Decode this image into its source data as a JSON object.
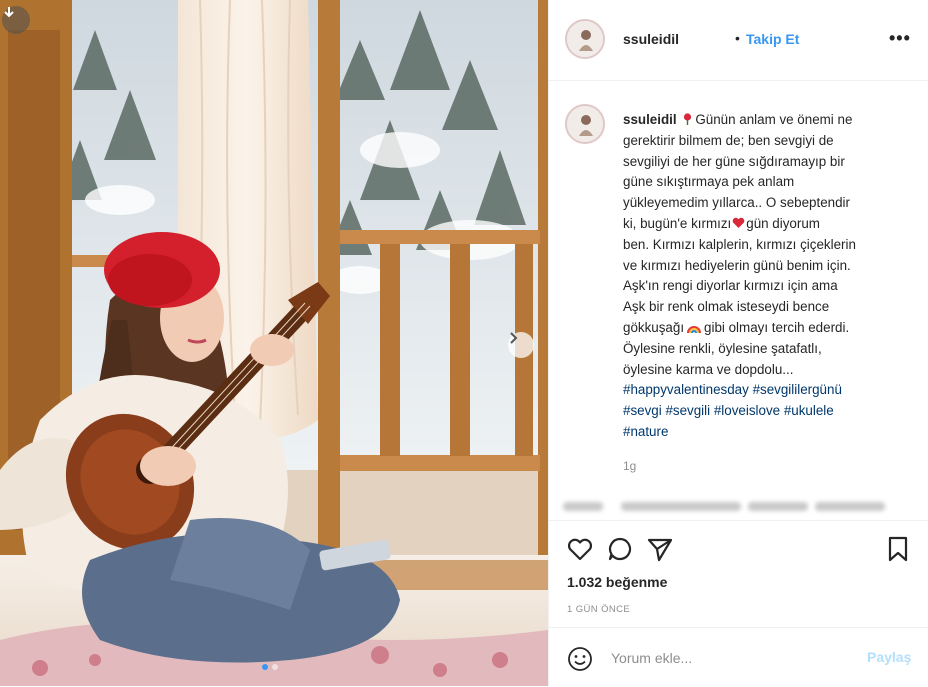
{
  "header": {
    "username": "ssuleidil",
    "separator": "•",
    "follow_label": "Takip Et",
    "more_label": "•••"
  },
  "caption": {
    "username": "ssuleidil",
    "lines": [
      "Günün anlam ve önemi ne",
      "gerektirir bilmem de; ben sevgiyi de",
      "sevgiliyi de her güne sığdıramayıp bir",
      "güne sıkıştırmaya pek anlam",
      "yükleyemedim yıllarca.. O sebeptendir",
      "ki, bugün'e kırmızı",
      "gün diyorum",
      "ben. Kırmızı kalplerin, kırmızı çiçeklerin",
      "ve kırmızı hediyelerin günü benim için.",
      "Aşk'ın rengi diyorlar kırmızı için ama",
      "Aşk bir renk olmak isteseydi bence",
      "gökkuşağı",
      "gibi olmayı tercih ederdi.",
      "Öylesine renkli, öylesine şatafatlı,",
      "öylesine karma ve dopdolu..."
    ],
    "hashtags_line1": [
      "#happyvalentinesday",
      "#sevgililergünü"
    ],
    "hashtags_line2": [
      "#sevgi",
      "#sevgili",
      "#loveislove",
      "#ukulele"
    ],
    "hashtags_line3": [
      "#nature"
    ],
    "time_ago": "1g"
  },
  "actions": {
    "likes": "1.032 beğenme",
    "date": "1 GÜN ÖNCE"
  },
  "comment": {
    "placeholder": "Yorum ekle...",
    "share_label": "Paylaş"
  },
  "colors": {
    "link_blue": "#3897f0",
    "hashtag_blue": "#00376b",
    "heart_red": "#d8283a",
    "share_disabled": "#b2dffc"
  },
  "icons": {
    "heart": "heart-icon",
    "comment": "comment-icon",
    "share": "send-icon",
    "save": "bookmark-icon",
    "emoji": "smiley-icon",
    "download": "download-icon",
    "next": "chevron-right-icon"
  },
  "carousel": {
    "total": 2,
    "active_index": 0
  }
}
